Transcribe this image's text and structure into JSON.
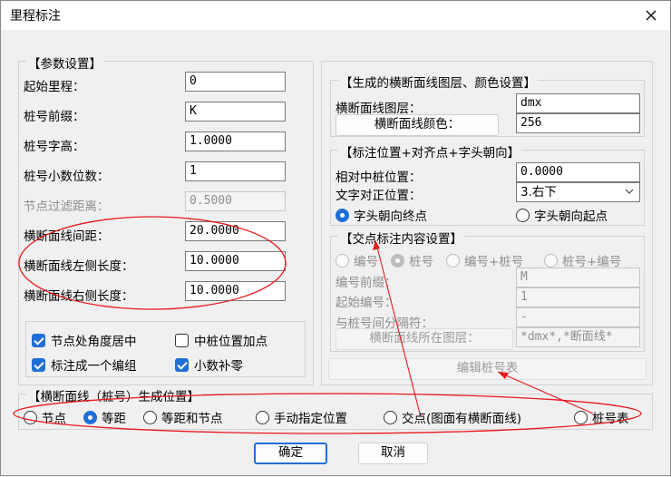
{
  "window": {
    "title": "里程标注"
  },
  "params": {
    "group_label": "【参数设置】",
    "start_mileage": {
      "label": "起始里程：",
      "value": "0"
    },
    "pile_prefix": {
      "label": "桩号前缀：",
      "value": "K"
    },
    "pile_font_height": {
      "label": "桩号字高：",
      "value": "1.0000"
    },
    "pile_decimals": {
      "label": "桩号小数位数：",
      "value": "1"
    },
    "node_filter": {
      "label": "节点过滤距离：",
      "value": "0.5000"
    },
    "section_spacing": {
      "label": "横断面线间距：",
      "value": "20.0000"
    },
    "left_length": {
      "label": "横断面线左侧长度：",
      "value": "10.0000"
    },
    "right_length": {
      "label": "横断面线右侧长度：",
      "value": "10.0000"
    },
    "checks": {
      "node_angle_center": {
        "label": "节点处角度居中",
        "checked": true
      },
      "add_center_point": {
        "label": "中桩位置加点",
        "checked": false
      },
      "make_group": {
        "label": "标注成一个编组",
        "checked": true
      },
      "pad_zeros": {
        "label": "小数补零",
        "checked": true
      }
    }
  },
  "layer_settings": {
    "group_label": "【生成的横断面线图层、颜色设置】",
    "layer_label": "横断面线图层：",
    "layer_value": "dmx",
    "color_button": "横断面线颜色：",
    "color_value": "256"
  },
  "position_settings": {
    "group_label": "【标注位置+对齐点+字头朝向】",
    "offset_label": "相对中桩位置：",
    "offset_value": "0.0000",
    "align_label": "文字对正位置：",
    "align_value": "3.右下",
    "head_to_end": "字头朝向终点",
    "head_to_start": "字头朝向起点",
    "head_selected": "end"
  },
  "intersection_settings": {
    "group_label": "【交点标注内容设置】",
    "opt_number": "编号",
    "opt_pile": "桩号",
    "opt_number_pile": "编号+桩号",
    "opt_pile_number": "桩号+编号",
    "number_prefix_label": "编号前缀：",
    "number_prefix_value": "M",
    "start_number_label": "起始编号：",
    "start_number_value": "1",
    "separator_label": "与桩号间分隔符：",
    "separator_value": "-",
    "layer_button": "横断面线所在图层：",
    "layer_value": "*dmx*,*断面线*"
  },
  "edit_pile_table": "编辑桩号表",
  "generation": {
    "group_label": "【横断面线（桩号）生成位置】",
    "options": [
      "节点",
      "等距",
      "等距和节点",
      "手动指定位置",
      "交点(图面有横断面线)",
      "桩号表"
    ],
    "selected": "等距"
  },
  "footer": {
    "ok": "确定",
    "cancel": "取消"
  },
  "colors": {
    "accent": "#1f6fd6",
    "annotation": "#e8191c"
  }
}
